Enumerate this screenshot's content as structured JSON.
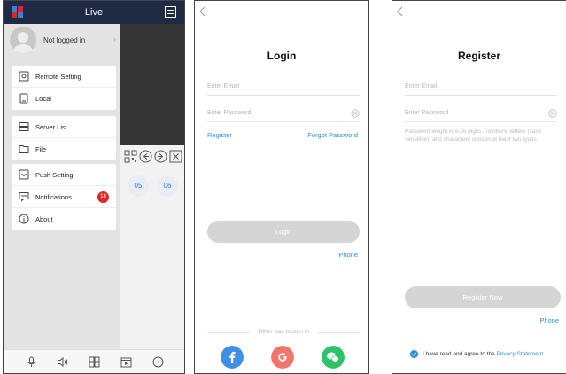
{
  "colors": {
    "accent": "#2f8fdc",
    "topbar": "#1f2a44",
    "badge": "#e0262c",
    "facebook": "#3f8ee8",
    "google": "#f2746b",
    "wechat": "#2fc267",
    "button_disabled": "#d5d5d5"
  },
  "live": {
    "title": "Live",
    "user_label": "Not logged in",
    "menu": [
      {
        "label": "Remote Setting",
        "icon": "remote-setting-icon"
      },
      {
        "label": "Local",
        "icon": "local-icon"
      },
      {
        "label": "Server List",
        "icon": "server-list-icon"
      },
      {
        "label": "File",
        "icon": "file-icon"
      },
      {
        "label": "Push Setting",
        "icon": "push-setting-icon"
      },
      {
        "label": "Notifications",
        "icon": "notifications-icon",
        "badge": "18"
      },
      {
        "label": "About",
        "icon": "info-icon"
      }
    ],
    "channels": [
      "05",
      "06"
    ],
    "bottom_icons": [
      "microphone-icon",
      "speaker-icon",
      "grid-icon",
      "playback-icon",
      "more-icon"
    ]
  },
  "login": {
    "title": "Login",
    "email_placeholder": "Enter Email",
    "password_placeholder": "Enter Password",
    "register_link": "Register",
    "forgot_link": "Forgot Password",
    "login_button": "Login",
    "phone_link": "Phone",
    "other_way": "Other way to sign in",
    "social": [
      "facebook-icon",
      "google-icon",
      "wechat-icon"
    ]
  },
  "register": {
    "title": "Register",
    "email_placeholder": "Enter Email",
    "password_placeholder": "Enter Password",
    "password_hint": "Password length is 8-16 digits, numbers, letters (case sensitive), and characters contain at least two types",
    "register_button": "Register Now",
    "phone_link": "Phone",
    "agree_text": "I have read and agree to the ",
    "privacy_link": "Privacy Statement"
  }
}
